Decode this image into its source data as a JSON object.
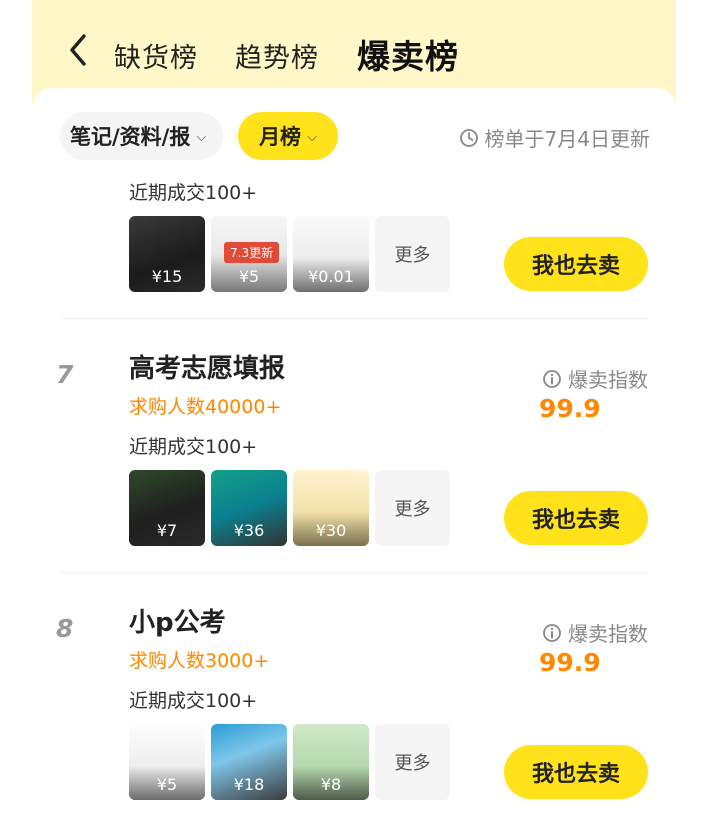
{
  "nav": {
    "tabs": [
      "缺货榜",
      "趋势榜",
      "爆卖榜"
    ],
    "active_tab_index": 2
  },
  "filters": {
    "category": "笔记/资料/报",
    "period": "月榜",
    "update_text": "榜单于7月4日更新"
  },
  "list": [
    {
      "recent": "近期成交100+",
      "thumbs": [
        {
          "price": "¥15",
          "tag": ""
        },
        {
          "price": "¥5",
          "tag": "7.3更新"
        },
        {
          "price": "¥0.01",
          "tag": ""
        }
      ],
      "more": "更多",
      "sell": "我也去卖"
    },
    {
      "rank": "7",
      "title": "高考志愿填报",
      "want": "求购人数40000+",
      "hot_label": "爆卖指数",
      "hot_value": "99.9",
      "recent": "近期成交100+",
      "thumbs": [
        {
          "price": "¥7"
        },
        {
          "price": "¥36"
        },
        {
          "price": "¥30"
        }
      ],
      "more": "更多",
      "sell": "我也去卖"
    },
    {
      "rank": "8",
      "title": "小p公考",
      "want": "求购人数3000+",
      "hot_label": "爆卖指数",
      "hot_value": "99.9",
      "recent": "近期成交100+",
      "thumbs": [
        {
          "price": "¥5"
        },
        {
          "price": "¥18"
        },
        {
          "price": "¥8"
        }
      ],
      "more": "更多",
      "sell": "我也去卖"
    }
  ],
  "colors": {
    "accent_yellow": "#ffe21a",
    "header_bg": "#fff7c7",
    "orange": "#ff8800"
  }
}
